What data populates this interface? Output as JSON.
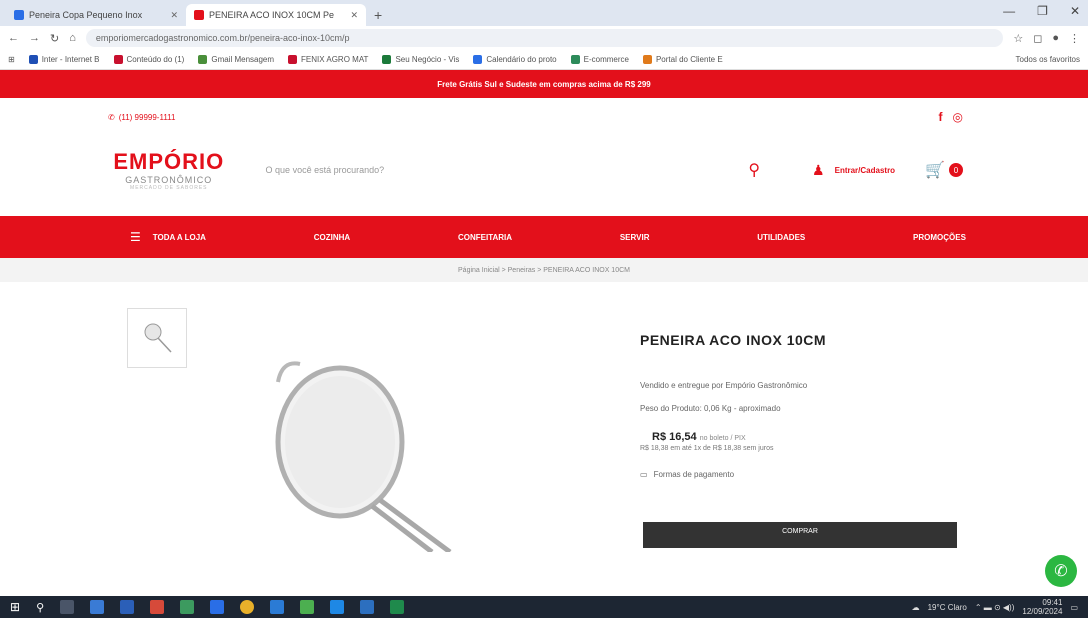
{
  "browser": {
    "tabs": [
      {
        "title": "Peneira Copa Pequeno Inox",
        "active": false,
        "color": "#2a6ee6"
      },
      {
        "title": "PENEIRA ACO INOX 10CM Pe",
        "active": true,
        "color": "#e3101b"
      }
    ],
    "new_tab": "+",
    "url": "emporiomercadogastronomico.com.br/peneira-aco-inox-10cm/p",
    "bookmarks": [
      {
        "label": "Inter - Internet B",
        "color": "#1f4fb5"
      },
      {
        "label": "Conteúdo do (1)",
        "color": "#c8102e"
      },
      {
        "label": "Gmail Mensagem",
        "color": "#4a8f3a"
      },
      {
        "label": "FENIX AGRO MAT",
        "color": "#c8102e"
      },
      {
        "label": "Seu Negócio - Vis",
        "color": "#1c7a3a"
      },
      {
        "label": "Calendário do proto",
        "color": "#2a6ee6"
      },
      {
        "label": "E-commerce",
        "color": "#2d8b5a"
      },
      {
        "label": "Portal do Cliente E",
        "color": "#e07a1b"
      }
    ],
    "bookmarks_right": "Todos os favoritos"
  },
  "promo": {
    "text": "Frete Grátis Sul e Sudeste em compras acima de R$ 299"
  },
  "topinfo": {
    "phone": "(11) 99999-1111",
    "facebook": "f",
    "instagram": "◎"
  },
  "header": {
    "logo_line1": "EMPÓRIO",
    "logo_line2": "GASTRONÔMICO",
    "logo_line3": "MERCADO DE SABORES",
    "search_placeholder": "O que você está procurando?",
    "account_label": "Entrar/Cadastro",
    "cart_count": "0"
  },
  "nav": {
    "items": [
      "TODA A LOJA",
      "COZINHA",
      "CONFEITARIA",
      "SERVIR",
      "UTILIDADES",
      "PROMOÇÕES"
    ]
  },
  "breadcrumb": "Página Inicial > Peneiras > PENEIRA ACO INOX 10CM",
  "product": {
    "title": "PENEIRA ACO INOX 10CM",
    "seller": "Vendido e entregue por Empório Gastronômico",
    "weight": "Peso do Produto: 0,06 Kg - aproximado",
    "price": "R$ 16,54",
    "price_note": "no boleto / PIX",
    "installments": "R$ 18,38 em até 1x de R$ 18,38 sem juros",
    "payment_link": "Formas de pagamento",
    "buy_label": "COMPRAR"
  },
  "taskbar": {
    "weather": "19°C Claro",
    "time": "09:41",
    "date": "12/09/2024"
  }
}
